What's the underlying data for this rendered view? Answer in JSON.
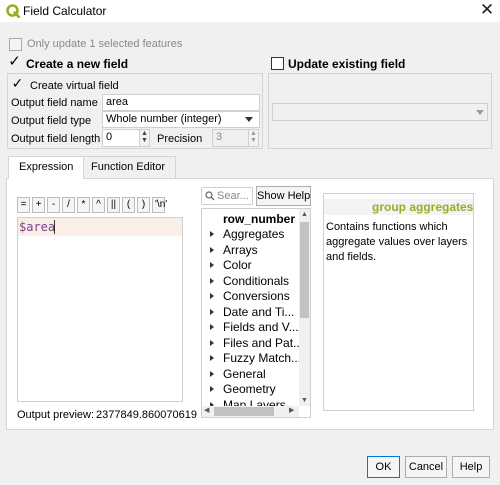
{
  "window": {
    "title": "Field Calculator",
    "close_icon": "close-icon",
    "logo_icon": "qgis-logo-icon",
    "logo_color": "#93b023"
  },
  "only_selected": {
    "label": "Only update 1 selected features",
    "checked": false,
    "enabled": false
  },
  "create_new_field": {
    "label": "Create a new field",
    "checked": true,
    "virtual_field": {
      "label": "Create virtual field",
      "checked": true
    },
    "output_field_name": {
      "label": "Output field name",
      "value": "area"
    },
    "output_field_type": {
      "label": "Output field type",
      "value": "Whole number (integer)"
    },
    "output_field_length": {
      "label": "Output field length",
      "value": "0"
    },
    "precision": {
      "label": "Precision",
      "value": "3"
    }
  },
  "update_existing": {
    "label": "Update existing field",
    "checked": false,
    "selected_value": ""
  },
  "tabs": [
    {
      "label": "Expression",
      "active": true
    },
    {
      "label": "Function Editor",
      "active": false
    }
  ],
  "operators": [
    "=",
    "+",
    "-",
    "/",
    "*",
    "^",
    "||",
    "(",
    ")",
    "'\\n'"
  ],
  "expression": {
    "text": "$area",
    "token_color": "#7a3f8e"
  },
  "output_preview": {
    "label": "Output preview:",
    "value": "2377849.860070619"
  },
  "search": {
    "placeholder": "Sear..."
  },
  "show_help_label": "Show Help",
  "function_tree": [
    {
      "label": "row_number",
      "bold": true,
      "expandable": false
    },
    {
      "label": "Aggregates",
      "expandable": true
    },
    {
      "label": "Arrays",
      "expandable": true
    },
    {
      "label": "Color",
      "expandable": true
    },
    {
      "label": "Conditionals",
      "expandable": true
    },
    {
      "label": "Conversions",
      "expandable": true
    },
    {
      "label": "Date and Ti...",
      "expandable": true
    },
    {
      "label": "Fields and V...",
      "expandable": true
    },
    {
      "label": "Files and Pat...",
      "expandable": true
    },
    {
      "label": "Fuzzy Match...",
      "expandable": true
    },
    {
      "label": "General",
      "expandable": true
    },
    {
      "label": "Geometry",
      "expandable": true
    },
    {
      "label": "Map Layers",
      "expandable": true
    }
  ],
  "help": {
    "title": "group aggregates",
    "text": "Contains functions which aggregate values over layers and fields."
  },
  "buttons": {
    "ok": "OK",
    "cancel": "Cancel",
    "help": "Help"
  }
}
